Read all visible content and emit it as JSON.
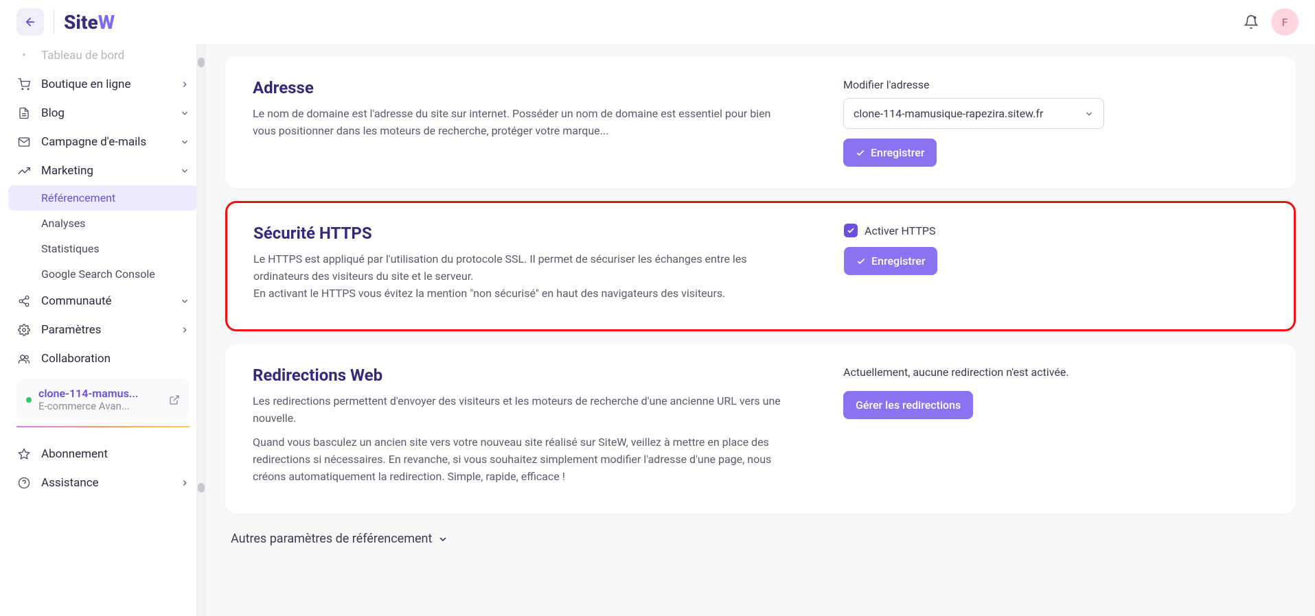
{
  "topbar": {
    "avatar_initial": "F"
  },
  "sidebar": {
    "items": [
      {
        "label": "Tableau de bord"
      },
      {
        "label": "Boutique en ligne"
      },
      {
        "label": "Blog"
      },
      {
        "label": "Campagne d'e-mails"
      },
      {
        "label": "Marketing"
      },
      {
        "label": "Communauté"
      },
      {
        "label": "Paramètres"
      },
      {
        "label": "Collaboration"
      }
    ],
    "marketing_sub": [
      {
        "label": "Référencement"
      },
      {
        "label": "Analyses"
      },
      {
        "label": "Statistiques"
      },
      {
        "label": "Google Search Console"
      }
    ],
    "site": {
      "name": "clone-114-mamus...",
      "plan": "E-commerce Avan..."
    },
    "bottom": [
      {
        "label": "Abonnement"
      },
      {
        "label": "Assistance"
      }
    ]
  },
  "cards": {
    "adresse": {
      "title": "Adresse",
      "desc": "Le nom de domaine est l'adresse du site sur internet. Posséder un nom de domaine est essentiel pour bien vous positionner dans les moteurs de recherche, protéger votre marque...",
      "field_label": "Modifier l'adresse",
      "domain": "clone-114-mamusique-rapezira.sitew.fr",
      "save": "Enregistrer"
    },
    "https": {
      "title": "Sécurité HTTPS",
      "desc1": "Le HTTPS est appliqué par l'utilisation du protocole SSL. Il permet de sécuriser les échanges entre les ordinateurs des visiteurs du site et le serveur.",
      "desc2": "En activant le HTTPS vous évitez la mention \"non sécurisé\" en haut des navigateurs des visiteurs.",
      "checkbox_label": "Activer HTTPS",
      "save": "Enregistrer"
    },
    "redir": {
      "title": "Redirections Web",
      "desc1": "Les redirections permettent d'envoyer des visiteurs et les moteurs de recherche d'une ancienne URL vers une nouvelle.",
      "desc2": "Quand vous basculez un ancien site vers votre nouveau site réalisé sur SiteW, veillez à mettre en place des redirections si nécessaires. En revanche, si vous souhaitez simplement modifier l'adresse d'une page, nous créons automatiquement la redirection. Simple, rapide, efficace !",
      "status": "Actuellement, aucune redirection n'est activée.",
      "manage": "Gérer les redirections"
    }
  },
  "collapse": "Autres paramètres de référencement"
}
